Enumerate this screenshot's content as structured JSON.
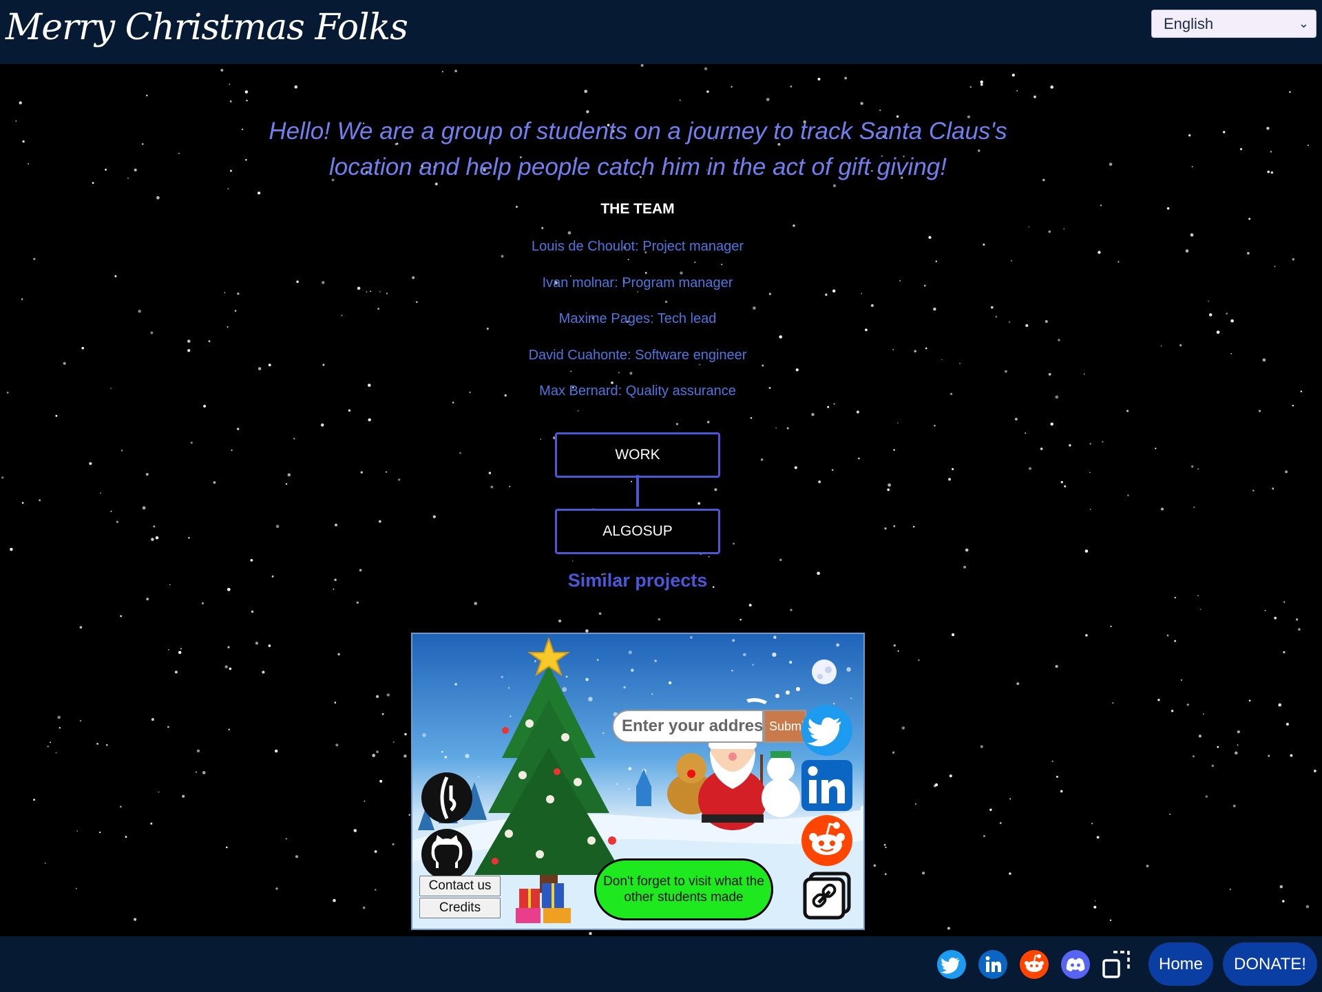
{
  "header": {
    "brand": "Merry Christmas Folks",
    "language_selected": "English"
  },
  "intro": "Hello! We are a group of students on a journey to track Santa Claus's location and help people catch him in the act of gift giving!",
  "team": {
    "title": "THE TEAM",
    "members": [
      "Louis de Choulot: Project manager",
      "Ivan molnar: Program manager",
      "Maxime Pages: Tech lead",
      "David Cuahonte: Software engineer",
      "Max Bernard: Quality assurance"
    ]
  },
  "flow": {
    "work_label": "WORK",
    "algosup_label": "ALGOSUP"
  },
  "similar_projects": {
    "title": "Similar projects",
    "preview": {
      "address_placeholder": "Enter your address",
      "submit_label": "Submit",
      "notice": "Don't forget to visit what the other students made",
      "contact_label": "Contact us",
      "credits_label": "Credits",
      "icons": [
        "moon-icon",
        "sleigh-icon",
        "twitter-icon",
        "linkedin-icon",
        "reddit-icon",
        "link-icon",
        "algosup-logo-icon",
        "github-icon",
        "christmas-tree-illustration",
        "santa-illustration"
      ]
    }
  },
  "footer": {
    "icons": [
      "twitter-icon",
      "linkedin-icon",
      "reddit-icon",
      "discord-icon",
      "external-window-icon"
    ],
    "home_label": "Home",
    "donate_label": "DONATE!"
  },
  "colors": {
    "topbar": "#061a33",
    "intro_text": "#7080ee",
    "member_text": "#4f76df",
    "accent_border": "#4a57d6",
    "footer_button": "#0b3ea3",
    "notice_bg": "#1ee81e"
  }
}
